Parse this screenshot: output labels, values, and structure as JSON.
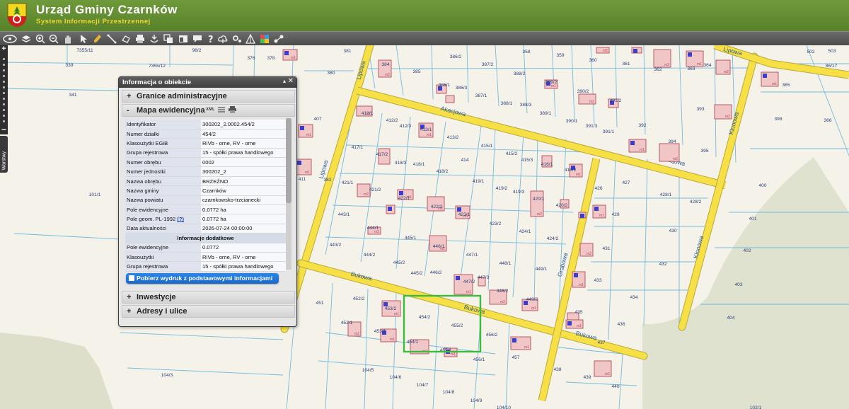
{
  "header": {
    "title": "Urząd Gminy Czarnków",
    "subtitle": "System Informacji Przestrzennej"
  },
  "toolbar": {
    "tools": [
      {
        "name": "fullextent-icon"
      },
      {
        "name": "layers-icon"
      },
      {
        "name": "zoom-in-icon"
      },
      {
        "name": "zoom-out-icon"
      },
      {
        "name": "pan-hand-icon"
      },
      {
        "name": "pointer-icon"
      },
      {
        "name": "info-pen-icon"
      },
      {
        "name": "measure-distance-icon"
      },
      {
        "name": "measure-area-icon"
      },
      {
        "name": "print-icon"
      },
      {
        "name": "search-parcel-icon"
      },
      {
        "name": "copy-icon"
      },
      {
        "name": "window-layout-icon"
      },
      {
        "name": "comment-icon"
      },
      {
        "name": "help-icon"
      },
      {
        "name": "upload-cloud-icon"
      },
      {
        "name": "settings-icon"
      },
      {
        "name": "shapes-icon"
      },
      {
        "name": "grid-colors-icon"
      },
      {
        "name": "share-icon"
      }
    ]
  },
  "map": {
    "zoom_in": "+",
    "zoom_out": "−",
    "layers_tab": "Warstwy",
    "streets": [
      {
        "label": "Lipowa"
      },
      {
        "label": "Akacjowa"
      },
      {
        "label": "Akacjowa"
      },
      {
        "label": "Lipowa"
      },
      {
        "label": "Bukowa"
      },
      {
        "label": "Bukowa"
      },
      {
        "label": "Bukowa"
      },
      {
        "label": "Grabowa"
      },
      {
        "label": "Klonowa"
      },
      {
        "label": "Klonowa"
      },
      {
        "label": "Lipowa"
      }
    ],
    "parcels": [
      "7355/11",
      "98/2",
      "376",
      "378",
      "381",
      "386/2",
      "358",
      "359",
      "360",
      "361",
      "362",
      "363",
      "364",
      "502",
      "503",
      "339",
      "7355/12",
      "341",
      "380",
      "384",
      "385",
      "386/1",
      "386/3",
      "387/2",
      "388/2",
      "389/2",
      "390/2",
      "391/2",
      "393",
      "394",
      "395",
      "366",
      "398",
      "86/17",
      "365",
      "412/1",
      "412/2",
      "412/3",
      "413/1",
      "413/2",
      "387/1",
      "388/1",
      "388/3",
      "389/1",
      "390/1",
      "391/3",
      "391/1",
      "392",
      "407",
      "417/1",
      "417/2",
      "418/3",
      "418/1",
      "418/2",
      "414",
      "415/1",
      "415/2",
      "415/3",
      "416/1",
      "416/2",
      "426",
      "427",
      "428/1",
      "428/2",
      "400",
      "401",
      "411",
      "382",
      "421/1",
      "421/2",
      "422/1",
      "422/2",
      "423/1",
      "419/1",
      "419/2",
      "419/3",
      "420/1",
      "420/2",
      "429",
      "430",
      "402",
      "101/1",
      "443/1",
      "444/1",
      "445/1",
      "423/2",
      "424/1",
      "424/2",
      "431",
      "432",
      "443/2",
      "444/2",
      "445/2",
      "446/1",
      "447/1",
      "448/1",
      "449/1",
      "433",
      "434",
      "403",
      "445/2",
      "446/2",
      "447/2",
      "447/3",
      "448/2",
      "449/2",
      "435",
      "436",
      "404",
      "451",
      "452/2",
      "453/2",
      "454/2",
      "455/2",
      "456/2",
      "457",
      "437",
      "452/1",
      "453/1",
      "454/1",
      "455/1",
      "456/1",
      "438",
      "439",
      "440",
      "104/3",
      "104/5",
      "104/6",
      "104/7",
      "104/8",
      "104/9",
      "104/10",
      "102/1"
    ],
    "buildings": [
      "m1",
      "m2",
      "bud"
    ]
  },
  "info_panel": {
    "title": "Informacja o obiekcie",
    "minimize": "▴",
    "close": "✕",
    "sections": [
      {
        "symbol": "+",
        "label": "Granice administracyjne"
      },
      {
        "symbol": "-",
        "label": "Mapa ewidencyjna"
      },
      {
        "symbol": "+",
        "label": "Inwestycje"
      },
      {
        "symbol": "+",
        "label": "Adresy i ulice"
      }
    ],
    "xml_label": "XML",
    "rows": [
      {
        "key": "Identyfikator",
        "value": "300202_2.0002.454/2"
      },
      {
        "key": "Numer działki",
        "value": "454/2"
      },
      {
        "key": "Klasoużytki EGiB",
        "value": "RIVb - orne, RV - orne"
      },
      {
        "key": "Grupa rejestrowa",
        "value": "15 - spółki prawa handlowego"
      },
      {
        "key": "Numer obrębu",
        "value": "0002"
      },
      {
        "key": "Numer jednostki",
        "value": "300202_2"
      },
      {
        "key": "Nazwa obrębu",
        "value": "BRZEŹNO"
      },
      {
        "key": "Nazwa gminy",
        "value": "Czarnków"
      },
      {
        "key": "Nazwa powiatu",
        "value": "czarnkowsko-trzcianecki"
      },
      {
        "key": "Pole ewidencyjne",
        "value": "0.0772 ha"
      },
      {
        "key": "Pole geom. PL-1992",
        "help": "(?)",
        "value": "0.0772 ha"
      },
      {
        "key": "Data aktualności",
        "value": "2026-07-24 00:00:00"
      }
    ],
    "sub_header": "Informacje dodatkowe",
    "extra_rows": [
      {
        "key": "Pole ewidencyjne",
        "value": "0.0772"
      },
      {
        "key": "Klasoużytki",
        "value": "RIVb - orne, RV - orne"
      },
      {
        "key": "Grupa rejestrowa",
        "value": "15 - spółki prawa handlowego"
      }
    ],
    "print_button": "Pobierz wydruk z podstawowymi informacjami"
  },
  "colors": {
    "header": "#62912f",
    "subtitle": "#f3d531",
    "road": "#f6e046",
    "road_edge": "#b8a93c",
    "parcel_line": "#6ab8d8",
    "building": "#f0c6c6",
    "building_edge": "#b3495a",
    "selection": "#3dbb3d",
    "forest": "#dfe2cf"
  }
}
